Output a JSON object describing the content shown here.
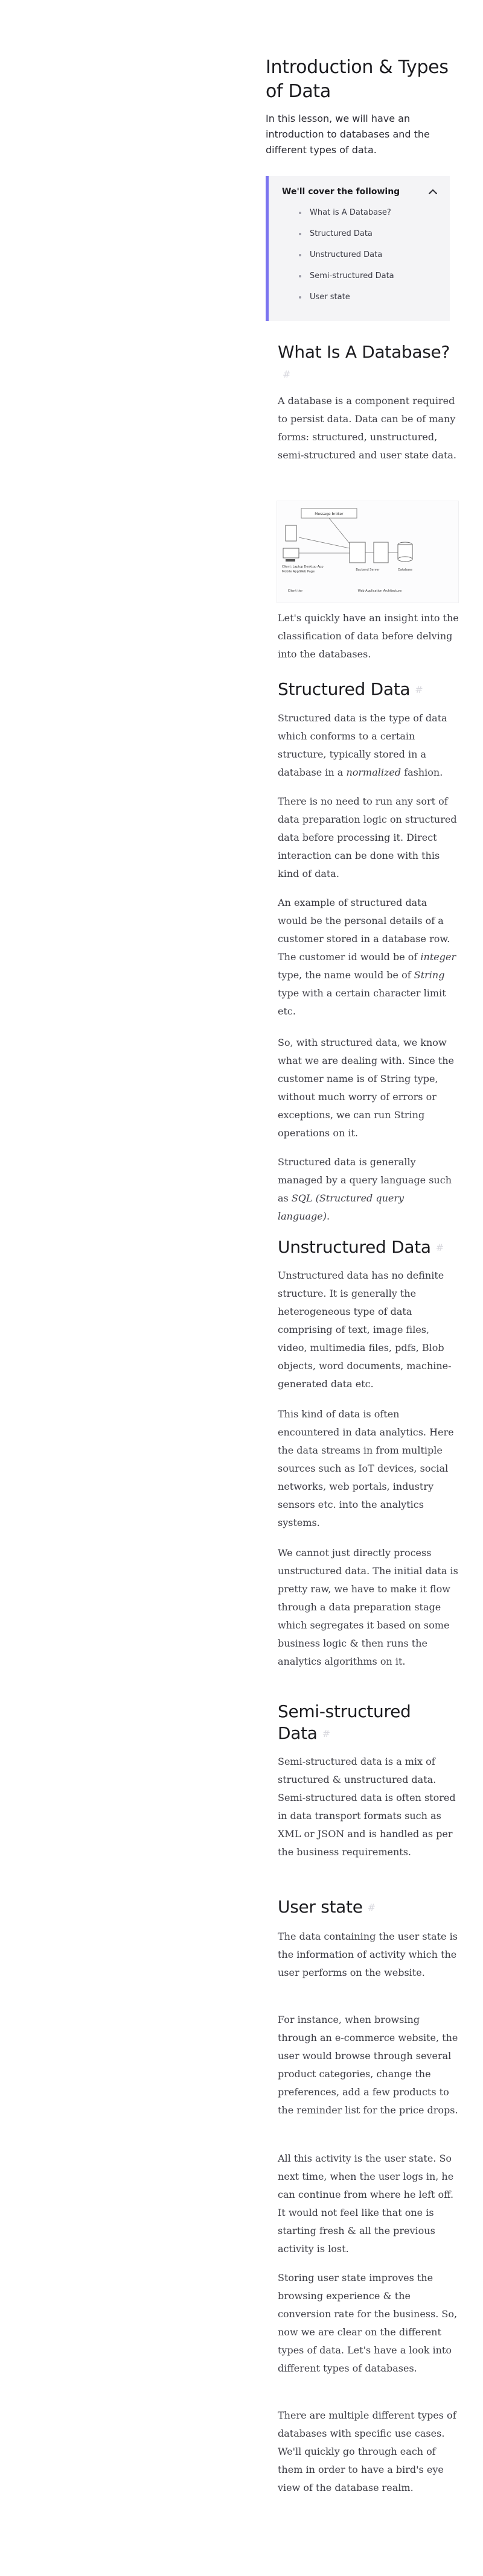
{
  "lesson": {
    "title": "Introduction & Types of Data",
    "intro": "In this lesson, we will have an introduction to databases and the different types of data."
  },
  "toc": {
    "heading": "We'll cover the following",
    "items": [
      {
        "label": "What is A Database?"
      },
      {
        "label": "Structured Data"
      },
      {
        "label": "Unstructured Data"
      },
      {
        "label": "Semi-structured Data"
      },
      {
        "label": "User state"
      }
    ]
  },
  "sections": {
    "what_is_db": {
      "title": "What Is A Database?",
      "p1": "A database is a component required to persist data. Data can be of many forms: structured, unstructured, semi-structured and user state data.",
      "p2": "Let's quickly have an insight into the classification of data before delving into the databases."
    },
    "structured": {
      "title": "Structured Data",
      "p1_a": "Structured data is the type of data which conforms to a certain structure, typically stored in a database in a ",
      "p1_em": "normalized",
      "p1_b": " fashion.",
      "p2": "There is no need to run any sort of data preparation logic on structured data before processing it. Direct interaction can be done with this kind of data.",
      "p3_a": "An example of structured data would be the personal details of a customer stored in a database row. The customer id would be of ",
      "p3_em1": "integer",
      "p3_b": " type, the name would be of ",
      "p3_em2": "String",
      "p3_c": " type with a certain character limit etc.",
      "p4": "So, with structured data, we know what we are dealing with. Since the customer name is of String type, without much worry of errors or exceptions, we can run String operations on it.",
      "p5_a": "Structured data is generally managed by a query language such as ",
      "p5_em": "SQL (Structured query language)",
      "p5_b": "."
    },
    "unstructured": {
      "title": "Unstructured Data",
      "p1": "Unstructured data has no definite structure. It is generally the heterogeneous type of data comprising of text, image files, video, multimedia files, pdfs, Blob objects, word documents, machine-generated data etc.",
      "p2": "This kind of data is often encountered in data analytics. Here the data streams in from multiple sources such as IoT devices, social networks, web portals, industry sensors etc. into the analytics systems.",
      "p3": "We cannot just directly process unstructured data. The initial data is pretty raw, we have to make it flow through a data preparation stage which segregates it based on some business logic & then runs the analytics algorithms on it."
    },
    "semi": {
      "title": "Semi-structured Data",
      "p1": "Semi-structured data is a mix of structured & unstructured data. Semi-structured data is often stored in data transport formats such as XML or JSON and is handled as per the business requirements."
    },
    "user_state": {
      "title": "User state",
      "p1": "The data containing the user state is the information of activity which the user performs on the website.",
      "p2": "For instance, when browsing through an e-commerce website, the user would browse through several product categories, change the preferences, add a few products to the reminder list for the price drops.",
      "p3": "All this activity is the user state. So next time, when the user logs in, he can continue from where he left off. It would not feel like that one is starting fresh & all the previous activity is lost.",
      "p4": "Storing user state improves the browsing experience & the conversion rate for the business. So, now we are clear on the different types of data. Let's have a look into different types of databases.",
      "p5": "There are multiple different types of databases with specific use cases. We'll quickly go through each of them in order to have a bird's eye view of the database realm."
    }
  },
  "diagram": {
    "box_top": "Message broker",
    "client_label": "Client: Laptop Desktop App",
    "client_sub": "Mobile App/Web Page",
    "server_label": "Backend Server",
    "db_label": "Database",
    "caption_left": "Client tier",
    "caption_right": "Web Application Architecture"
  },
  "colors": {
    "accent": "#7b74f0",
    "toc_bg": "#f4f4f6",
    "heading": "#1b1b1f",
    "body": "#3d3d45"
  }
}
